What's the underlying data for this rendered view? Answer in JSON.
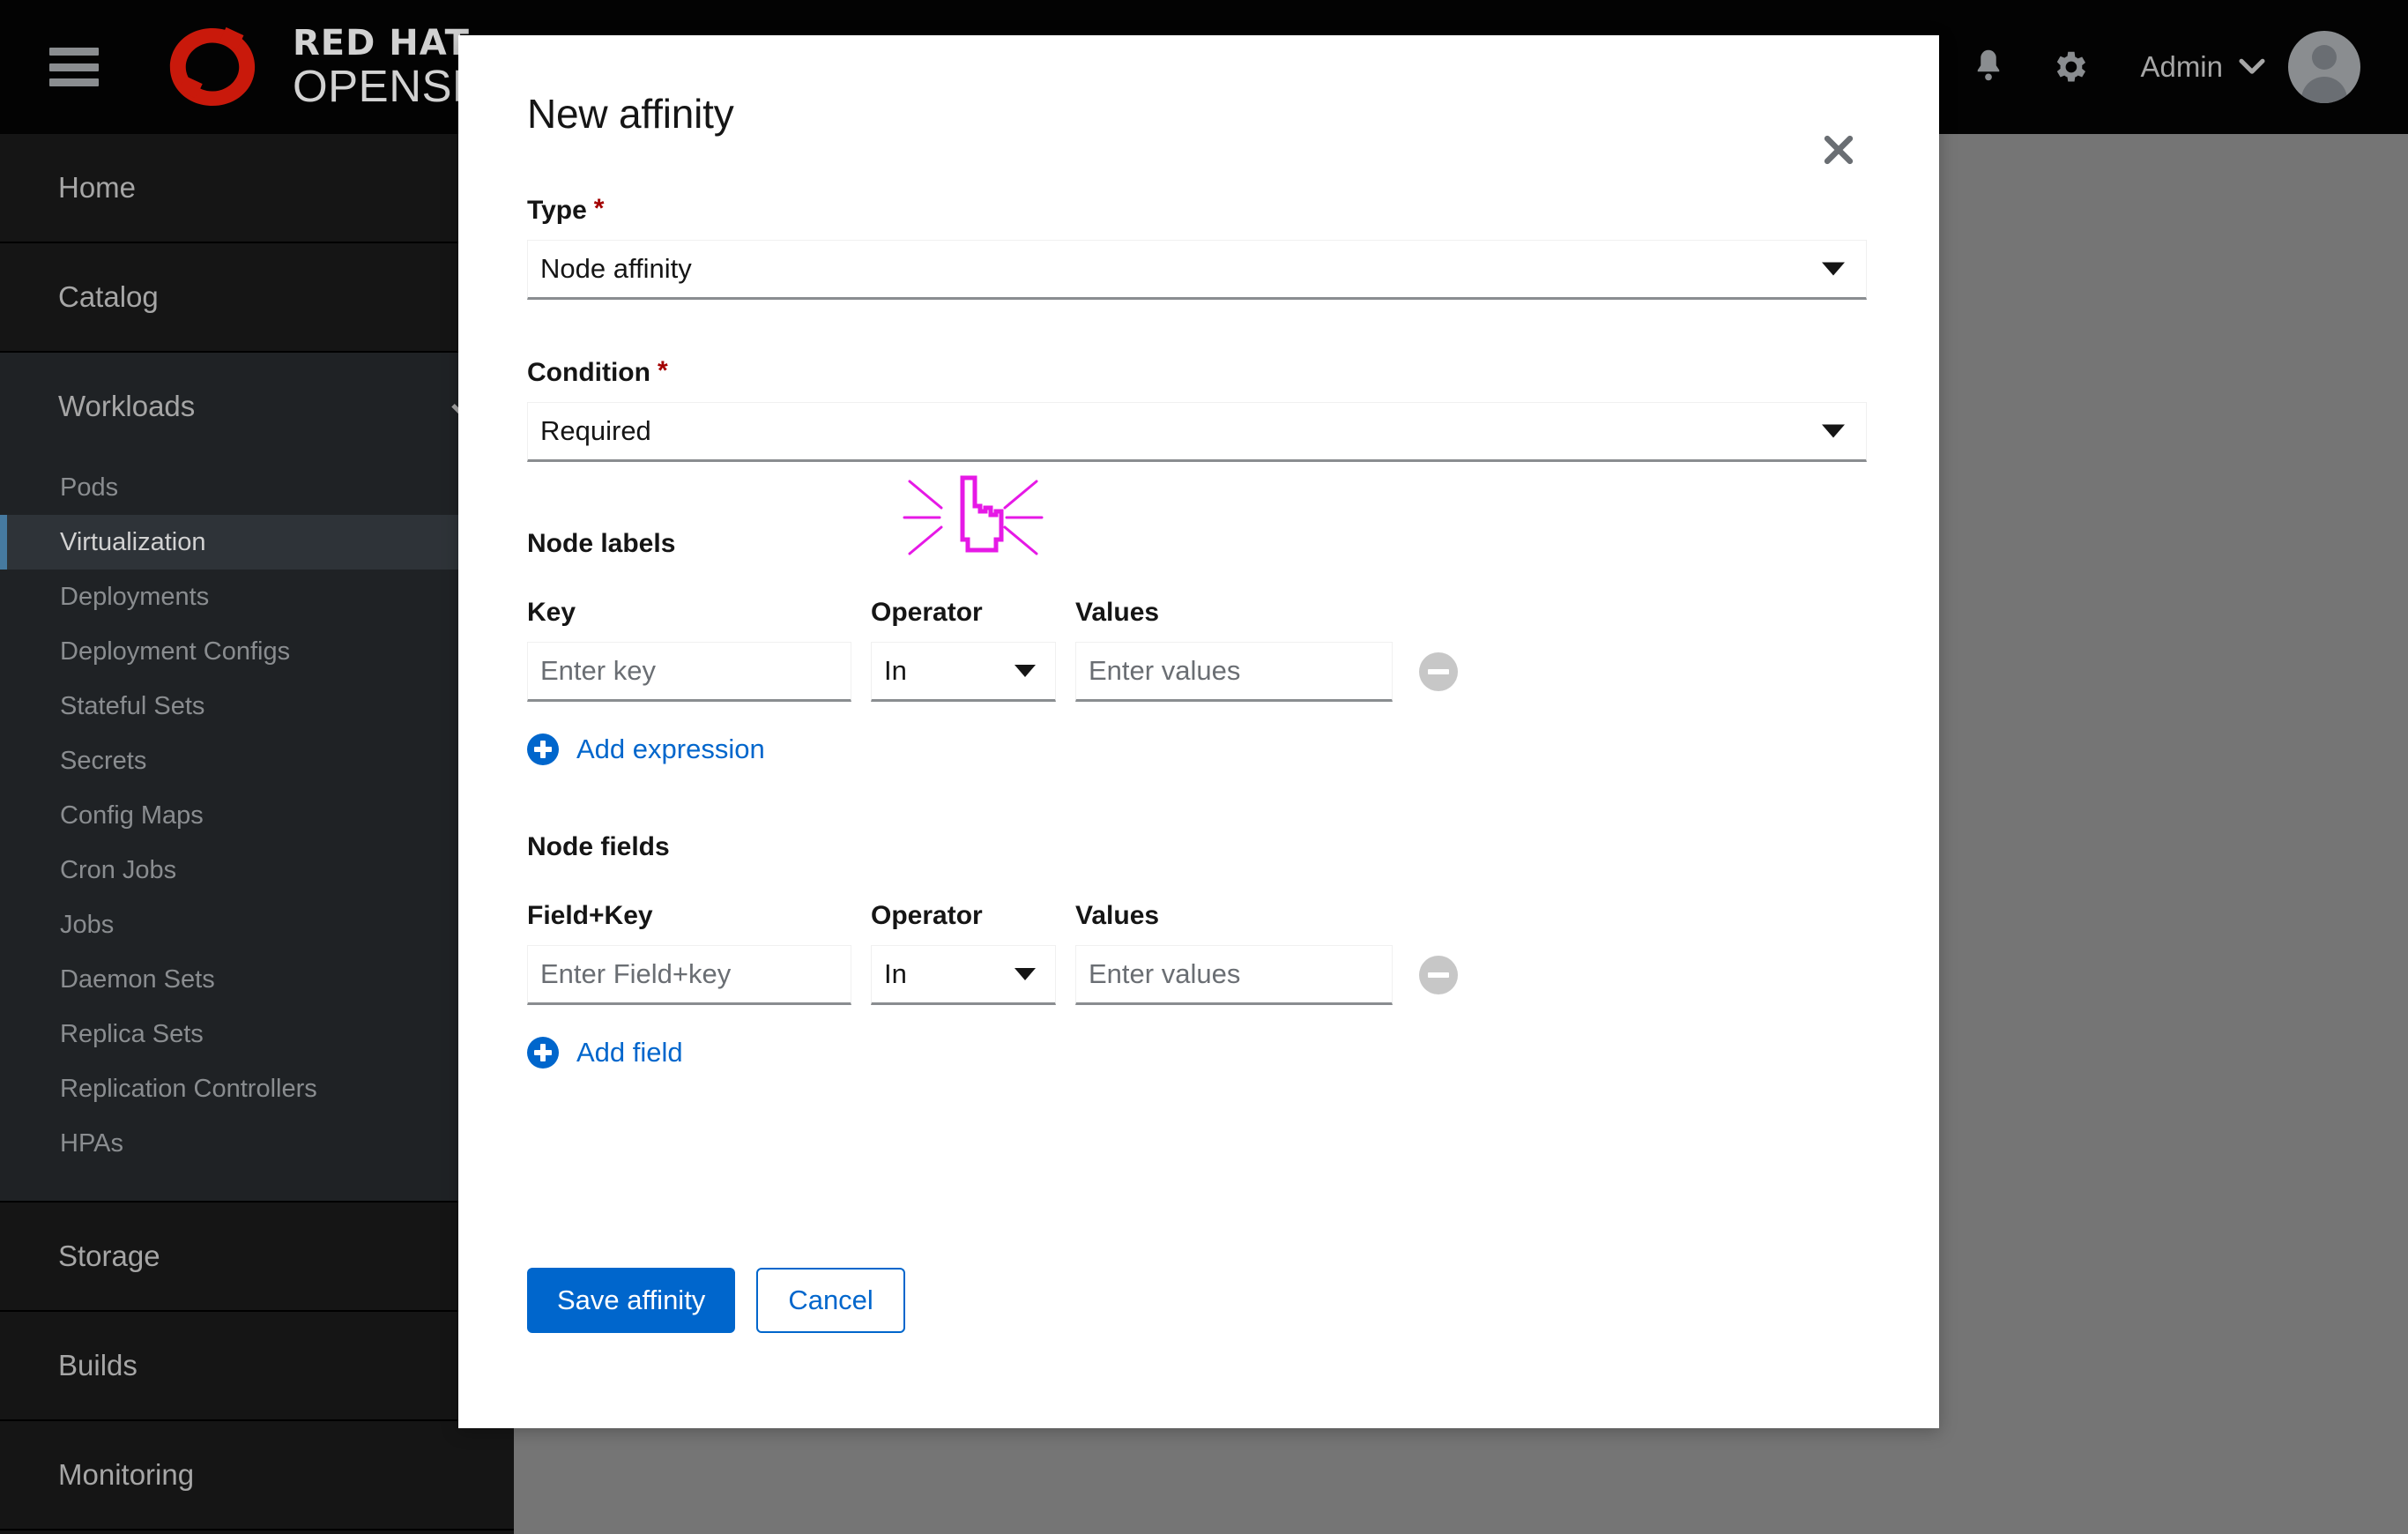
{
  "masthead": {
    "hamburger_label": "Global navigation toggle",
    "brand_line1": "RED HAT",
    "brand_line2": "OPENSHIFT",
    "brand_tm": "®",
    "notifications_icon": "bell-icon",
    "settings_icon": "gear-icon",
    "user_name": "Admin",
    "user_caret_icon": "chevron-down-icon",
    "avatar_icon": "avatar"
  },
  "sidebar": {
    "groups": [
      {
        "label": "Home",
        "expanded": false,
        "items": []
      },
      {
        "label": "Catalog",
        "expanded": false,
        "items": []
      },
      {
        "label": "Workloads",
        "expanded": true,
        "items": [
          {
            "label": "Pods",
            "active": false
          },
          {
            "label": "Virtualization",
            "active": true
          },
          {
            "label": "Deployments",
            "active": false
          },
          {
            "label": "Deployment Configs",
            "active": false
          },
          {
            "label": "Stateful Sets",
            "active": false
          },
          {
            "label": "Secrets",
            "active": false
          },
          {
            "label": "Config Maps",
            "active": false
          },
          {
            "label": "Cron Jobs",
            "active": false
          },
          {
            "label": "Jobs",
            "active": false
          },
          {
            "label": "Daemon Sets",
            "active": false
          },
          {
            "label": "Replica Sets",
            "active": false
          },
          {
            "label": "Replication Controllers",
            "active": false
          },
          {
            "label": "HPAs",
            "active": false
          }
        ]
      },
      {
        "label": "Storage",
        "expanded": false,
        "items": []
      },
      {
        "label": "Builds",
        "expanded": false,
        "items": []
      },
      {
        "label": "Monitoring",
        "expanded": false,
        "items": []
      }
    ]
  },
  "modal": {
    "title": "New affinity",
    "close_icon": "close-icon",
    "type": {
      "label": "Type",
      "required_marker": "*",
      "value": "Node affinity"
    },
    "condition": {
      "label": "Condition",
      "required_marker": "*",
      "value": "Required"
    },
    "node_labels": {
      "heading": "Node labels",
      "col_key": "Key",
      "col_operator": "Operator",
      "col_values": "Values",
      "key_placeholder": "Enter key",
      "operator_value": "In",
      "values_placeholder": "Enter values",
      "remove_icon": "minus-circle-icon",
      "add_label": "Add expression",
      "add_icon": "plus-circle-icon"
    },
    "node_fields": {
      "heading": "Node fields",
      "col_key": "Field+Key",
      "col_operator": "Operator",
      "col_values": "Values",
      "key_placeholder": "Enter Field+key",
      "operator_value": "In",
      "values_placeholder": "Enter values",
      "remove_icon": "minus-circle-icon",
      "add_label": "Add field",
      "add_icon": "plus-circle-icon"
    },
    "save_label": "Save affinity",
    "cancel_label": "Cancel"
  },
  "annotation": {
    "cursor_icon": "click-cursor-icon",
    "cursor_color": "#e619e6"
  },
  "colors": {
    "brand_red": "#c9190b",
    "masthead_bg": "#030303",
    "sidebar_bg": "#151515",
    "sidebar_group_bg": "#1f2225",
    "active_item_bg": "#2e3338",
    "active_accent": "#467aa0",
    "overlay": "#757575",
    "primary_blue": "#0066cc",
    "required_red": "#a30000",
    "input_border_bottom": "#8a8d90"
  }
}
